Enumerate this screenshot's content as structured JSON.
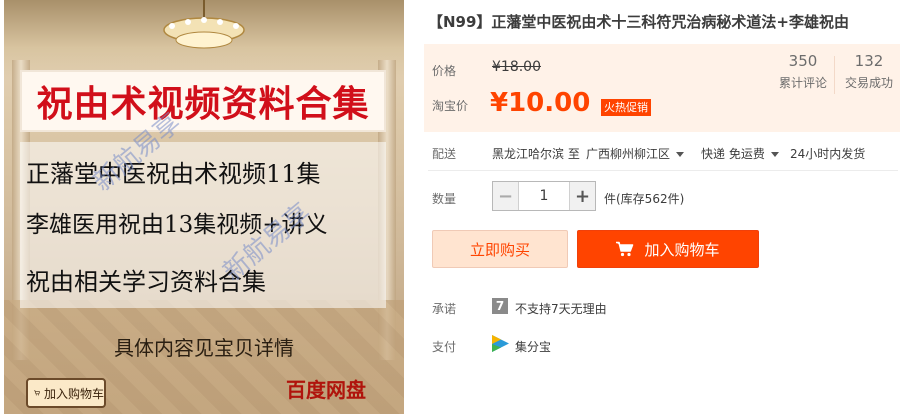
{
  "product_image": {
    "banner_title": "祝由术视频资料合集",
    "lines": [
      "正藩堂中医祝由术视频11集",
      "李雄医用祝由13集视频+讲义",
      "祝由相关学习资料合集"
    ],
    "watermark": "新航易享",
    "subtitle": "具体内容见宝贝详情",
    "cart_badge": "加入购物车",
    "baidu_label": "百度网盘"
  },
  "product": {
    "title": "【N99】正藩堂中医祝由术十三科符咒治病秘术道法+李雄祝由"
  },
  "price": {
    "price_label": "价格",
    "original_price": "¥18.00",
    "sale_label": "淘宝价",
    "sale_price": "¥10.00",
    "promo_badge": "火热促销",
    "reviews_count": "350",
    "reviews_label": "累计评论",
    "sales_count": "132",
    "sales_label": "交易成功"
  },
  "shipping": {
    "label": "配送",
    "from": "黑龙江哈尔滨 至",
    "destination": "广西柳州柳江区",
    "method": "快递 免运费",
    "dispatch": "24小时内发货"
  },
  "quantity": {
    "label": "数量",
    "value": "1",
    "stock_text": "件(库存562件)"
  },
  "actions": {
    "buy_now": "立即购买",
    "add_to_cart": "加入购物车"
  },
  "promise": {
    "label": "承诺",
    "icon_text": "7",
    "text": "不支持7天无理由"
  },
  "payment": {
    "label": "支付",
    "method": "集分宝"
  },
  "colors": {
    "accent": "#ff4400",
    "price_panel_bg": "#fff2e8",
    "banner_red": "#d10f1a"
  }
}
